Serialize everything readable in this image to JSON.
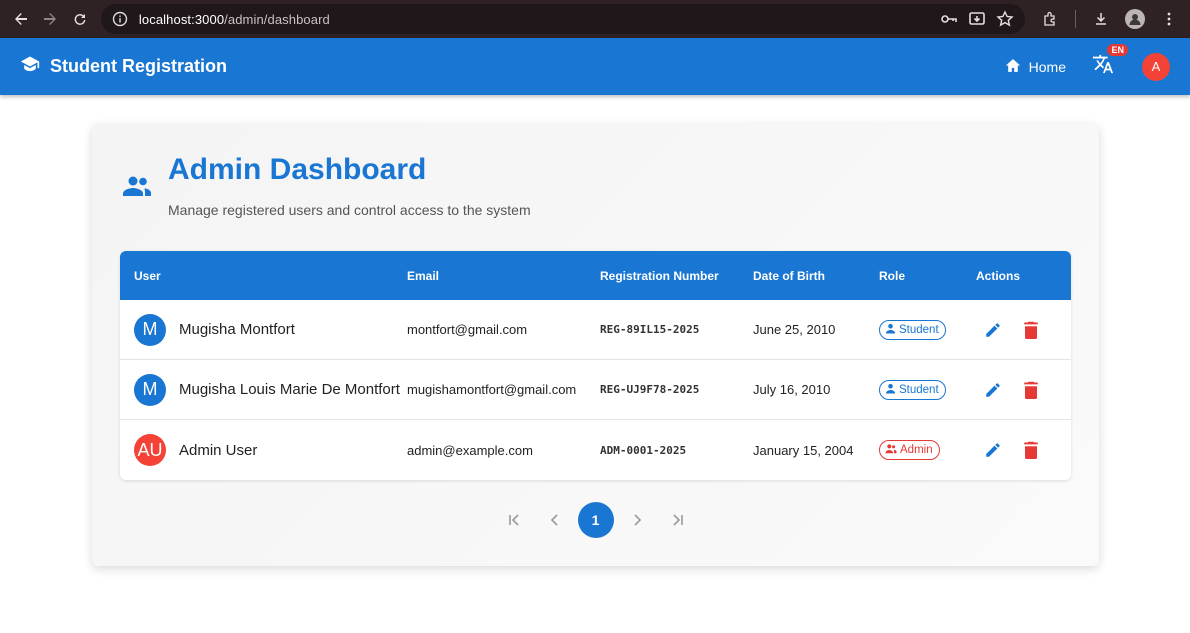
{
  "browser": {
    "url_host": "localhost:3000",
    "url_path": "/admin/dashboard"
  },
  "appbar": {
    "brand": "Student Registration",
    "home_label": "Home",
    "lang_badge": "EN",
    "avatar_initial": "A",
    "color": "#1976d2"
  },
  "dashboard": {
    "title": "Admin Dashboard",
    "subtitle": "Manage registered users and control access to the system"
  },
  "table": {
    "headers": [
      "User",
      "Email",
      "Registration Number",
      "Date of Birth",
      "Role",
      "Actions"
    ],
    "rows": [
      {
        "initials": "M",
        "avatar_color": "#1976d2",
        "name": "Mugisha Montfort",
        "email": "montfort@gmail.com",
        "reg": "REG-89IL15-2025",
        "dob": "June 25, 2010",
        "role": "Student"
      },
      {
        "initials": "M",
        "avatar_color": "#1976d2",
        "name": "Mugisha Louis Marie De Montfort",
        "email": "mugishamontfort@gmail.com",
        "reg": "REG-UJ9F78-2025",
        "dob": "July 16, 2010",
        "role": "Student"
      },
      {
        "initials": "AU",
        "avatar_color": "#f44336",
        "name": "Admin User",
        "email": "admin@example.com",
        "reg": "ADM-0001-2025",
        "dob": "January 15, 2004",
        "role": "Admin"
      }
    ]
  },
  "pagination": {
    "current_page": "1"
  },
  "colors": {
    "primary": "#1976d2",
    "danger": "#e53935"
  }
}
